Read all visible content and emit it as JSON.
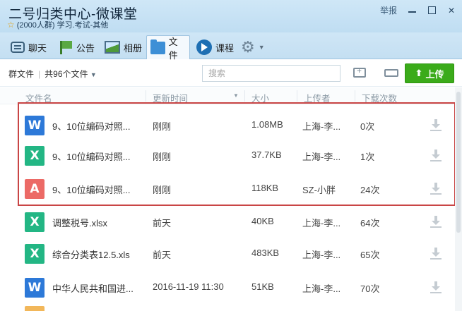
{
  "window": {
    "title": "二号归类中心-微课堂",
    "member_count": "(2000人群)",
    "category": "学习.考试-其他",
    "report_label": "举报"
  },
  "tabs": [
    {
      "label": "聊天",
      "icon": "chat-icon"
    },
    {
      "label": "公告",
      "icon": "flag-icon"
    },
    {
      "label": "相册",
      "icon": "photo-icon"
    },
    {
      "label": "文件",
      "icon": "folder-icon",
      "active": true
    },
    {
      "label": "课程",
      "icon": "course-play-icon"
    }
  ],
  "toolbar": {
    "group_files": "群文件",
    "file_count": "共96个文件",
    "search_placeholder": "搜索",
    "upload_label": "上传"
  },
  "table": {
    "headers": [
      "文件名",
      "更新时间",
      "大小",
      "上传者",
      "下载次数"
    ],
    "rows": [
      {
        "type": "word",
        "badge": "W",
        "name": "9、10位编码对照...",
        "time": "刚刚",
        "size": "1.08MB",
        "uploader": "上海-李...",
        "downloads": "0次"
      },
      {
        "type": "excel",
        "badge": "X",
        "name": "9、10位编码对照...",
        "time": "刚刚",
        "size": "37.7KB",
        "uploader": "上海-李...",
        "downloads": "1次"
      },
      {
        "type": "pdf",
        "badge": "A",
        "name": "9、10位编码对照...",
        "time": "刚刚",
        "size": "118KB",
        "uploader": "SZ-小胖",
        "downloads": "24次"
      },
      {
        "type": "excel",
        "badge": "X",
        "name": "调整税号.xlsx",
        "time": "前天",
        "size": "40KB",
        "uploader": "上海-李...",
        "downloads": "64次"
      },
      {
        "type": "excel",
        "badge": "X",
        "name": "综合分类表12.5.xls",
        "time": "前天",
        "size": "483KB",
        "uploader": "上海-李...",
        "downloads": "65次"
      },
      {
        "type": "word",
        "badge": "W",
        "name": "中华人民共和国进...",
        "time": "2016-11-19 11:30",
        "size": "51KB",
        "uploader": "上海-李...",
        "downloads": "70次"
      }
    ]
  },
  "colors": {
    "upload_green": "#3bab1a",
    "highlight_red": "#c94545",
    "word_blue": "#2d79d8",
    "excel_green": "#23b684",
    "pdf_red": "#ec6a66"
  }
}
